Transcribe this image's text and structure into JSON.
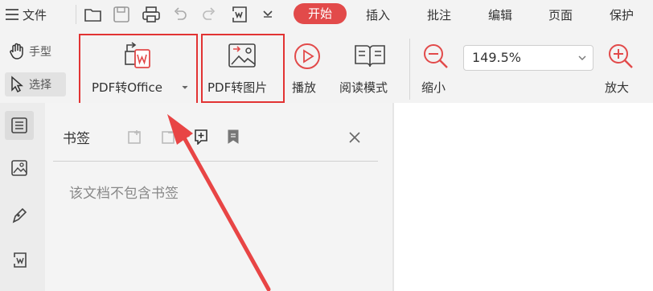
{
  "menubar": {
    "menu_label": "文件",
    "tabs": [
      {
        "label": "开始",
        "active": true
      },
      {
        "label": "插入",
        "active": false
      },
      {
        "label": "批注",
        "active": false
      },
      {
        "label": "编辑",
        "active": false
      },
      {
        "label": "页面",
        "active": false
      },
      {
        "label": "保护",
        "active": false
      }
    ]
  },
  "ribbon": {
    "hand_label": "手型",
    "select_label": "选择",
    "pdf_to_office_label": "PDF转Office",
    "pdf_to_image_label": "PDF转图片",
    "play_label": "播放",
    "read_mode_label": "阅读模式",
    "zoom_value": "149.5%",
    "zoom_out_label": "缩小",
    "zoom_in_label": "放大"
  },
  "bookmarks": {
    "title": "书签",
    "empty_text": "该文档不包含书签"
  },
  "colors": {
    "accent": "#e24a4a",
    "highlight_box": "#e23333",
    "arrow": "#e84545"
  }
}
